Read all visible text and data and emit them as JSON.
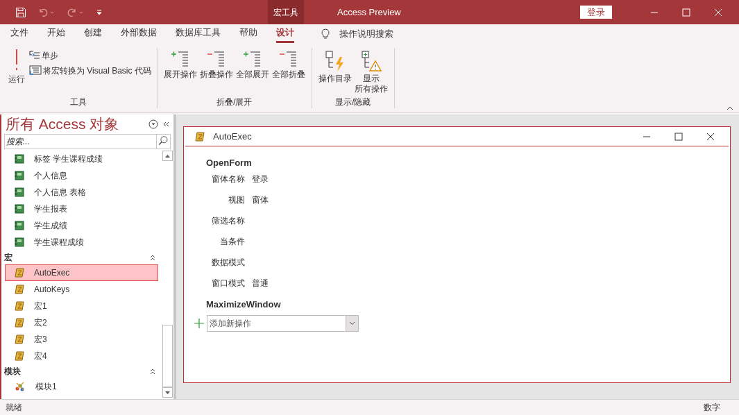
{
  "title_bar": {
    "contextual_tab": "宏工具",
    "title": "Access Preview",
    "sign_in": "登录"
  },
  "menu_tabs": [
    {
      "label": "文件",
      "selected": false
    },
    {
      "label": "开始",
      "selected": false
    },
    {
      "label": "创建",
      "selected": false
    },
    {
      "label": "外部数据",
      "selected": false
    },
    {
      "label": "数据库工具",
      "selected": false
    },
    {
      "label": "帮助",
      "selected": false
    },
    {
      "label": "设计",
      "selected": true
    }
  ],
  "tell_me": "操作说明搜索",
  "ribbon": {
    "groups": [
      {
        "label": "工具",
        "buttons": [
          {
            "kind": "run",
            "label": "运行"
          },
          {
            "kind": "step",
            "label": "单步"
          },
          {
            "kind": "convert",
            "label": "将宏转换为 Visual Basic 代码"
          }
        ]
      },
      {
        "label": "折叠/展开",
        "buttons": [
          {
            "kind": "expand",
            "label": "展开操作"
          },
          {
            "kind": "collapse",
            "label": "折叠操作"
          },
          {
            "kind": "expand",
            "label": "全部展开"
          },
          {
            "kind": "collapse",
            "label": "全部折叠"
          }
        ]
      },
      {
        "label": "显示/隐藏",
        "buttons": [
          {
            "kind": "catalog",
            "label": "操作目录"
          },
          {
            "kind": "show_all",
            "lines": [
              "显示",
              "所有操作"
            ]
          }
        ]
      }
    ]
  },
  "nav": {
    "title": "所有 Access 对象",
    "search_placeholder": "搜索...",
    "entries": [
      {
        "kind": "report",
        "label": "标签 学生课程成绩",
        "selected": false
      },
      {
        "kind": "report",
        "label": "个人信息",
        "selected": false
      },
      {
        "kind": "report",
        "label": "个人信息 表格",
        "selected": false
      },
      {
        "kind": "report",
        "label": "学生报表",
        "selected": false
      },
      {
        "kind": "report",
        "label": "学生成绩",
        "selected": false
      },
      {
        "kind": "report",
        "label": "学生课程成绩",
        "selected": false
      },
      {
        "kind": "header",
        "label": "宏"
      },
      {
        "kind": "macro",
        "label": "AutoExec",
        "selected": true
      },
      {
        "kind": "macro",
        "label": "AutoKeys",
        "selected": false
      },
      {
        "kind": "macro",
        "label": "宏1",
        "selected": false
      },
      {
        "kind": "macro",
        "label": "宏2",
        "selected": false
      },
      {
        "kind": "macro",
        "label": "宏3",
        "selected": false
      },
      {
        "kind": "macro",
        "label": "宏4",
        "selected": false
      },
      {
        "kind": "header",
        "label": "模块"
      },
      {
        "kind": "module",
        "label": "模块1",
        "selected": false
      }
    ]
  },
  "macro": {
    "title": "AutoExec",
    "actions": [
      {
        "name": "OpenForm",
        "arguments": [
          {
            "label": "窗体名称",
            "value": "登录"
          },
          {
            "label": "视图",
            "value": "窗体"
          },
          {
            "label": "筛选名称"
          },
          {
            "label": "当条件"
          },
          {
            "label": "数据模式"
          },
          {
            "label": "窗口模式",
            "value": "普通"
          }
        ]
      },
      {
        "name": "MaximizeWindow"
      }
    ],
    "add_action_placeholder": "添加新操作"
  },
  "status_bar": {
    "left": "就绪",
    "right": "数字"
  }
}
